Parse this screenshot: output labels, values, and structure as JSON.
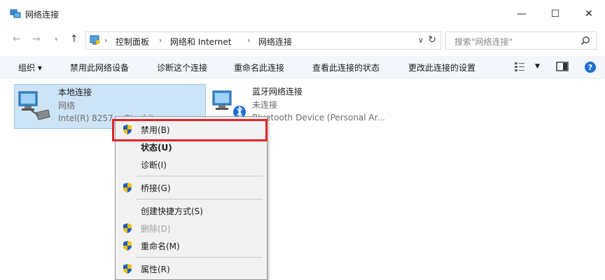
{
  "window": {
    "title": "网络连接",
    "minimize": "—",
    "maximize": "☐",
    "close": "✕"
  },
  "address": {
    "crumbs": [
      "控制面板",
      "网络和 Internet",
      "网络连接"
    ],
    "search_placeholder": "搜索\"网络连接\""
  },
  "toolbar": {
    "organize": "组织 ▾",
    "items": [
      "禁用此网络设备",
      "诊断这个连接",
      "重命名此连接",
      "查看此连接的状态",
      "更改此连接的设置"
    ]
  },
  "connections": [
    {
      "name": "本地连接",
      "status": "网络",
      "device": "Intel(R) 8257... Gigabit ...",
      "selected": true
    },
    {
      "name": "蓝牙网络连接",
      "status": "未连接",
      "device": "Bluetooth Device (Personal Ar..."
    }
  ],
  "context_menu": {
    "items": [
      {
        "label": "禁用(B)",
        "shield": true,
        "bold": false,
        "disabled": false,
        "highlighted": true
      },
      {
        "label": "状态(U)",
        "shield": false,
        "bold": true,
        "disabled": false
      },
      {
        "label": "诊断(I)",
        "shield": false,
        "bold": false,
        "disabled": false
      },
      {
        "label": "桥接(G)",
        "shield": true,
        "bold": false,
        "disabled": false
      },
      {
        "label": "创建快捷方式(S)",
        "shield": false,
        "bold": false,
        "disabled": false
      },
      {
        "label": "删除(D)",
        "shield": true,
        "bold": false,
        "disabled": true
      },
      {
        "label": "重命名(M)",
        "shield": true,
        "bold": false,
        "disabled": false
      },
      {
        "label": "属性(R)",
        "shield": true,
        "bold": false,
        "disabled": false
      }
    ]
  },
  "colors": {
    "highlight_border": "#e0252b",
    "selection": "#cde4f7",
    "shield_blue": "#1f5fbf",
    "shield_yellow": "#f2c200"
  }
}
